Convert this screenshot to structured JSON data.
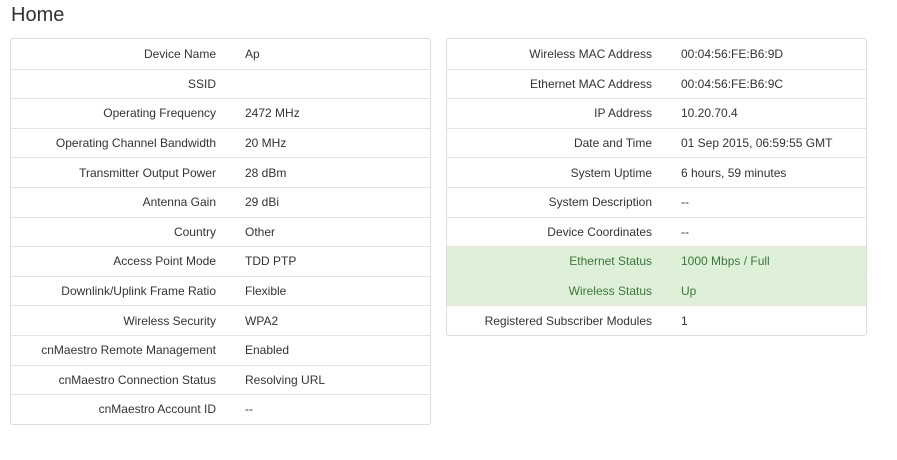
{
  "page": {
    "title": "Home"
  },
  "left_panel": {
    "rows": [
      {
        "label": "Device Name",
        "value": "Ap"
      },
      {
        "label": "SSID",
        "value": ""
      },
      {
        "label": "Operating Frequency",
        "value": "2472 MHz"
      },
      {
        "label": "Operating Channel Bandwidth",
        "value": "20 MHz"
      },
      {
        "label": "Transmitter Output Power",
        "value": "28 dBm"
      },
      {
        "label": "Antenna Gain",
        "value": "29 dBi"
      },
      {
        "label": "Country",
        "value": "Other"
      },
      {
        "label": "Access Point Mode",
        "value": "TDD PTP"
      },
      {
        "label": "Downlink/Uplink Frame Ratio",
        "value": "Flexible"
      },
      {
        "label": "Wireless Security",
        "value": "WPA2"
      },
      {
        "label": "cnMaestro Remote Management",
        "value": "Enabled"
      },
      {
        "label": "cnMaestro Connection Status",
        "value": "Resolving URL"
      },
      {
        "label": "cnMaestro Account ID",
        "value": "--"
      }
    ]
  },
  "right_panel": {
    "rows": [
      {
        "label": "Wireless MAC Address",
        "value": "00:04:56:FE:B6:9D"
      },
      {
        "label": "Ethernet MAC Address",
        "value": "00:04:56:FE:B6:9C"
      },
      {
        "label": "IP Address",
        "value": "10.20.70.4"
      },
      {
        "label": "Date and Time",
        "value": "01 Sep 2015, 06:59:55 GMT"
      },
      {
        "label": "System Uptime",
        "value": "6 hours, 59 minutes"
      },
      {
        "label": "System Description",
        "value": "--"
      },
      {
        "label": "Device Coordinates",
        "value": "--"
      },
      {
        "label": "Ethernet Status",
        "value": "1000 Mbps / Full"
      },
      {
        "label": "Wireless Status",
        "value": "Up"
      },
      {
        "label": "Registered Subscriber Modules",
        "value": "1"
      }
    ]
  },
  "colors": {
    "highlight_bg": "#dff0d8",
    "highlight_text": "#3c763d",
    "border": "#dddddd"
  }
}
